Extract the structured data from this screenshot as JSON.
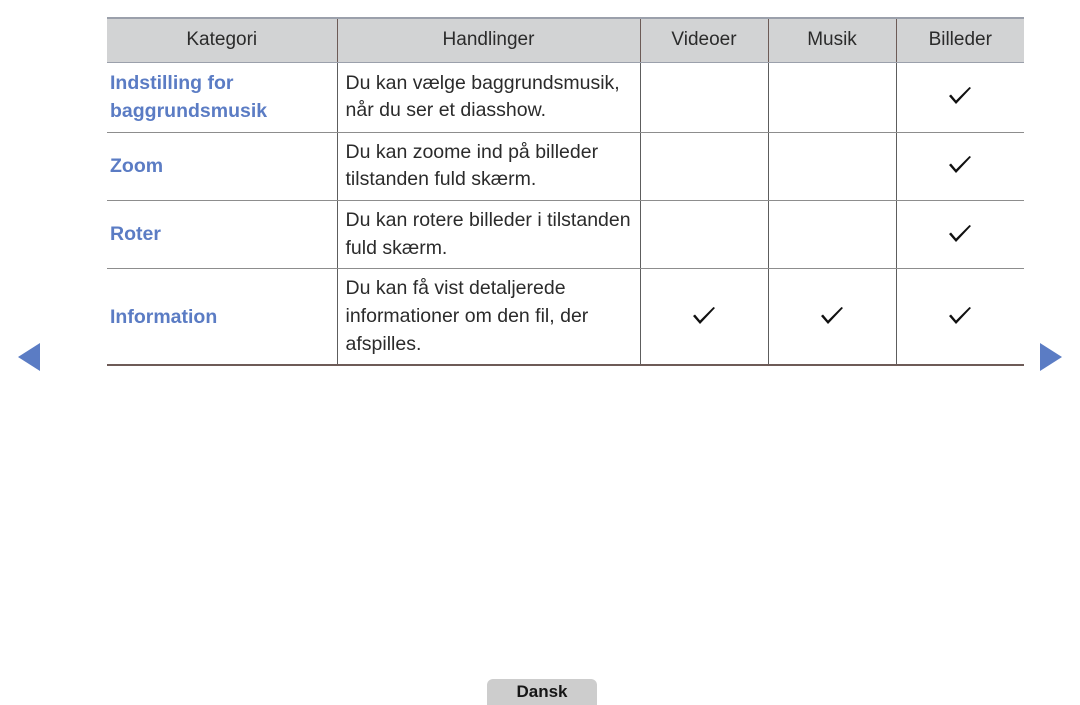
{
  "table": {
    "columns": [
      {
        "key": "kategori",
        "label": "Kategori"
      },
      {
        "key": "handlinger",
        "label": "Handlinger"
      },
      {
        "key": "videoer",
        "label": "Videoer"
      },
      {
        "key": "musik",
        "label": "Musik"
      },
      {
        "key": "billeder",
        "label": "Billeder"
      }
    ],
    "rows": [
      {
        "category": "Indstilling for baggrundsmusik",
        "action": "Du kan vælge baggrundsmusik, når du ser et diasshow.",
        "videoer": false,
        "musik": false,
        "billeder": true
      },
      {
        "category": "Zoom",
        "action": "Du kan zoome ind på billeder tilstanden fuld skærm.",
        "videoer": false,
        "musik": false,
        "billeder": true
      },
      {
        "category": "Roter",
        "action": "Du kan rotere billeder i tilstanden fuld skærm.",
        "videoer": false,
        "musik": false,
        "billeder": true
      },
      {
        "category": "Information",
        "action": "Du kan få vist detaljerede informationer om den fil, der afspilles.",
        "videoer": true,
        "musik": true,
        "billeder": true
      }
    ]
  },
  "navigation": {
    "previous_label": "◀",
    "next_label": "▶",
    "previous_icon": "triangle-left-icon",
    "next_icon": "triangle-right-icon"
  },
  "footer": {
    "language_label": "Dansk"
  },
  "colors": {
    "accent_blue": "#5b7cc4",
    "header_bg": "#d2d3d4",
    "button_bg": "#cdcdcd",
    "text": "#2b2b2b"
  }
}
